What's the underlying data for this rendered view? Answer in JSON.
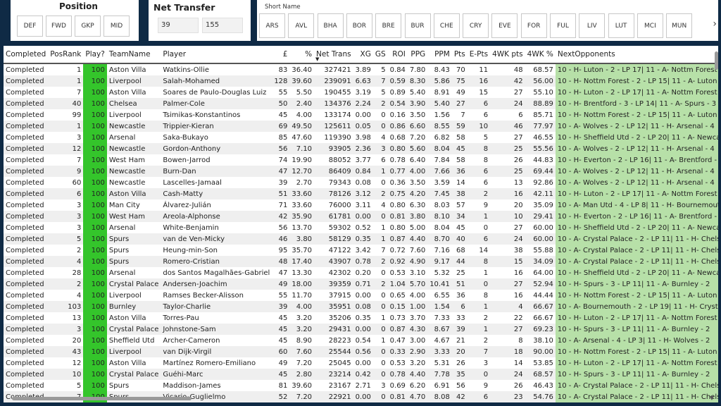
{
  "position_slicer": {
    "title": "Position",
    "options": [
      "DEF",
      "FWD",
      "GKP",
      "MID"
    ]
  },
  "net_transfer": {
    "title": "Net Transfer",
    "min": "39",
    "max": "155"
  },
  "short_name": {
    "title": "Short Name",
    "options": [
      "ARS",
      "AVL",
      "BHA",
      "BOR",
      "BRE",
      "BUR",
      "CHE",
      "CRY",
      "EVE",
      "FOR",
      "FUL",
      "LIV",
      "LUT",
      "MCI",
      "MUN"
    ],
    "next_icon": "chevron-right-icon"
  },
  "table": {
    "headers": [
      "Completed",
      "PosRank",
      "Play?",
      "TeamName",
      "Player",
      "£",
      "%",
      "Net Trans",
      "XG",
      "GS",
      "ROI",
      "PPG",
      "PPM",
      "Pts",
      "E-Pts",
      "4WK pts",
      "4WK %",
      "NextOpponents"
    ],
    "sorted_column": "Net Trans",
    "colors": {
      "play": "#34c52b",
      "next": "#b7e0a8"
    },
    "rows": [
      [
        "Completed",
        "1",
        "100",
        "Aston Villa",
        "Watkins-Ollie",
        "83",
        "36.40",
        "327421",
        "3.89",
        "5",
        "0.84",
        "7.80",
        "8.43",
        "70",
        "11",
        "48",
        "68.57",
        "10 - H- Luton - 2 - LP 17| 11 - A- Nottm Forest"
      ],
      [
        "Completed",
        "1",
        "100",
        "Liverpool",
        "Salah-Mohamed",
        "128",
        "39.60",
        "239091",
        "6.63",
        "7",
        "0.59",
        "8.30",
        "5.86",
        "75",
        "16",
        "42",
        "56.00",
        "10 - H- Nottm Forest - 2 - LP 15| 11 - A- Luton"
      ],
      [
        "Completed",
        "7",
        "100",
        "Aston Villa",
        "Soares de Paulo-Douglas Luiz",
        "55",
        "5.50",
        "190455",
        "3.19",
        "5",
        "0.89",
        "5.40",
        "8.91",
        "49",
        "15",
        "27",
        "55.10",
        "10 - H- Luton - 2 - LP 17| 11 - A- Nottm Forest"
      ],
      [
        "Completed",
        "40",
        "100",
        "Chelsea",
        "Palmer-Cole",
        "50",
        "2.40",
        "134376",
        "2.24",
        "2",
        "0.54",
        "3.90",
        "5.40",
        "27",
        "6",
        "24",
        "88.89",
        "10 - H- Brentford - 3 - LP 14| 11 - A- Spurs - 3"
      ],
      [
        "Completed",
        "99",
        "100",
        "Liverpool",
        "Tsimikas-Konstantinos",
        "45",
        "4.00",
        "133174",
        "0.00",
        "0",
        "0.16",
        "3.50",
        "1.56",
        "7",
        "6",
        "6",
        "85.71",
        "10 - H- Nottm Forest - 2 - LP 15| 11 - A- Luton"
      ],
      [
        "Completed",
        "1",
        "100",
        "Newcastle",
        "Trippier-Kieran",
        "69",
        "49.50",
        "125611",
        "0.05",
        "0",
        "0.86",
        "6.60",
        "8.55",
        "59",
        "10",
        "46",
        "77.97",
        "10 - A- Wolves - 2 - LP 12| 11 - H- Arsenal - 4"
      ],
      [
        "Completed",
        "3",
        "100",
        "Arsenal",
        "Saka-Bukayo",
        "85",
        "47.60",
        "119390",
        "3.98",
        "4",
        "0.68",
        "7.20",
        "6.82",
        "58",
        "5",
        "27",
        "46.55",
        "10 - H- Sheffield Utd - 2 - LP 20| 11 - A- Newcastle"
      ],
      [
        "Completed",
        "12",
        "100",
        "Newcastle",
        "Gordon-Anthony",
        "56",
        "7.10",
        "93905",
        "2.36",
        "3",
        "0.80",
        "5.60",
        "8.04",
        "45",
        "8",
        "25",
        "55.56",
        "10 - A- Wolves - 2 - LP 12| 11 - H- Arsenal - 4"
      ],
      [
        "Completed",
        "7",
        "100",
        "West Ham",
        "Bowen-Jarrod",
        "74",
        "19.90",
        "88052",
        "3.77",
        "6",
        "0.78",
        "6.40",
        "7.84",
        "58",
        "8",
        "26",
        "44.83",
        "10 - H- Everton - 2 - LP 16| 11 - A- Brentford - 3"
      ],
      [
        "Completed",
        "9",
        "100",
        "Newcastle",
        "Burn-Dan",
        "47",
        "12.70",
        "86409",
        "0.84",
        "1",
        "0.77",
        "4.00",
        "7.66",
        "36",
        "6",
        "25",
        "69.44",
        "10 - A- Wolves - 2 - LP 12| 11 - H- Arsenal - 4"
      ],
      [
        "Completed",
        "60",
        "100",
        "Newcastle",
        "Lascelles-Jamaal",
        "39",
        "2.70",
        "79343",
        "0.08",
        "0",
        "0.36",
        "3.50",
        "3.59",
        "14",
        "6",
        "13",
        "92.86",
        "10 - A- Wolves - 2 - LP 12| 11 - H- Arsenal - 4"
      ],
      [
        "Completed",
        "6",
        "100",
        "Aston Villa",
        "Cash-Matty",
        "51",
        "33.60",
        "78126",
        "3.12",
        "2",
        "0.75",
        "4.20",
        "7.45",
        "38",
        "2",
        "16",
        "42.11",
        "10 - H- Luton - 2 - LP 17| 11 - A- Nottm Forest"
      ],
      [
        "Completed",
        "3",
        "100",
        "Man City",
        "Álvarez-Julián",
        "71",
        "33.60",
        "76000",
        "3.11",
        "4",
        "0.80",
        "6.30",
        "8.03",
        "57",
        "9",
        "20",
        "35.09",
        "10 - A- Man Utd - 4 - LP 8| 11 - H- Bournemouth"
      ],
      [
        "Completed",
        "3",
        "100",
        "West Ham",
        "Areola-Alphonse",
        "42",
        "35.90",
        "61781",
        "0.00",
        "0",
        "0.81",
        "3.80",
        "8.10",
        "34",
        "1",
        "10",
        "29.41",
        "10 - H- Everton - 2 - LP 16| 11 - A- Brentford - 3"
      ],
      [
        "Completed",
        "3",
        "100",
        "Arsenal",
        "White-Benjamin",
        "56",
        "13.70",
        "59302",
        "0.52",
        "1",
        "0.80",
        "5.00",
        "8.04",
        "45",
        "0",
        "27",
        "60.00",
        "10 - H- Sheffield Utd - 2 - LP 20| 11 - A- Newcastle"
      ],
      [
        "Completed",
        "5",
        "100",
        "Spurs",
        "van de Ven-Micky",
        "46",
        "3.80",
        "58129",
        "0.35",
        "1",
        "0.87",
        "4.40",
        "8.70",
        "40",
        "6",
        "24",
        "60.00",
        "10 - A- Crystal Palace - 2 - LP 11| 11 - H- Chelsea"
      ],
      [
        "Completed",
        "2",
        "100",
        "Spurs",
        "Heung-min-Son",
        "95",
        "35.70",
        "47122",
        "3.42",
        "7",
        "0.72",
        "7.60",
        "7.16",
        "68",
        "14",
        "38",
        "55.88",
        "10 - A- Crystal Palace - 2 - LP 11| 11 - H- Chelsea"
      ],
      [
        "Completed",
        "4",
        "100",
        "Spurs",
        "Romero-Cristian",
        "48",
        "17.40",
        "43907",
        "0.78",
        "2",
        "0.92",
        "4.90",
        "9.17",
        "44",
        "8",
        "15",
        "34.09",
        "10 - A- Crystal Palace - 2 - LP 11| 11 - H- Chelsea"
      ],
      [
        "Completed",
        "28",
        "100",
        "Arsenal",
        "dos Santos Magalhães-Gabriel",
        "47",
        "13.30",
        "42302",
        "0.20",
        "0",
        "0.53",
        "3.10",
        "5.32",
        "25",
        "1",
        "16",
        "64.00",
        "10 - H- Sheffield Utd - 2 - LP 20| 11 - A- Newcastle"
      ],
      [
        "Completed",
        "2",
        "100",
        "Crystal Palace",
        "Andersen-Joachim",
        "49",
        "18.00",
        "39359",
        "0.71",
        "2",
        "1.04",
        "5.70",
        "10.41",
        "51",
        "0",
        "27",
        "52.94",
        "10 - H- Spurs - 3 - LP 11| 11 - A- Burnley - 2"
      ],
      [
        "Completed",
        "4",
        "100",
        "Liverpool",
        "Ramses Becker-Alisson",
        "55",
        "11.70",
        "37915",
        "0.00",
        "0",
        "0.65",
        "4.00",
        "6.55",
        "36",
        "8",
        "16",
        "44.44",
        "10 - H- Nottm Forest - 2 - LP 15| 11 - A- Luton"
      ],
      [
        "Completed",
        "103",
        "100",
        "Burnley",
        "Taylor-Charlie",
        "39",
        "4.00",
        "35951",
        "0.08",
        "0",
        "0.15",
        "1.00",
        "1.54",
        "6",
        "1",
        "4",
        "66.67",
        "10 - A- Bournemouth - 2 - LP 19| 11 - H- Crystal Palace"
      ],
      [
        "Completed",
        "13",
        "100",
        "Aston Villa",
        "Torres-Pau",
        "45",
        "3.20",
        "35206",
        "0.35",
        "1",
        "0.73",
        "3.70",
        "7.33",
        "33",
        "2",
        "22",
        "66.67",
        "10 - H- Luton - 2 - LP 17| 11 - A- Nottm Forest"
      ],
      [
        "Completed",
        "3",
        "100",
        "Crystal Palace",
        "Johnstone-Sam",
        "45",
        "3.20",
        "29431",
        "0.00",
        "0",
        "0.87",
        "4.30",
        "8.67",
        "39",
        "1",
        "27",
        "69.23",
        "10 - H- Spurs - 3 - LP 11| 11 - A- Burnley - 2"
      ],
      [
        "Completed",
        "20",
        "100",
        "Sheffield Utd",
        "Archer-Cameron",
        "45",
        "8.90",
        "28223",
        "0.54",
        "1",
        "0.47",
        "3.00",
        "4.67",
        "21",
        "2",
        "8",
        "38.10",
        "10 - A- Arsenal - 4 - LP 3| 11 - H- Wolves - 2"
      ],
      [
        "Completed",
        "43",
        "100",
        "Liverpool",
        "van Dijk-Virgil",
        "60",
        "7.60",
        "25544",
        "0.56",
        "0",
        "0.33",
        "2.90",
        "3.33",
        "20",
        "7",
        "18",
        "90.00",
        "10 - H- Nottm Forest - 2 - LP 15| 11 - A- Luton"
      ],
      [
        "Completed",
        "12",
        "100",
        "Aston Villa",
        "Martínez Romero-Emiliano",
        "49",
        "7.20",
        "25045",
        "0.00",
        "0",
        "0.53",
        "3.20",
        "5.31",
        "26",
        "3",
        "14",
        "53.85",
        "10 - H- Luton - 2 - LP 17| 11 - A- Nottm Forest"
      ],
      [
        "Completed",
        "10",
        "100",
        "Crystal Palace",
        "Guéhi-Marc",
        "45",
        "2.80",
        "23214",
        "0.42",
        "0",
        "0.78",
        "4.40",
        "7.78",
        "35",
        "0",
        "24",
        "68.57",
        "10 - H- Spurs - 3 - LP 11| 11 - A- Burnley - 2"
      ],
      [
        "Completed",
        "5",
        "100",
        "Spurs",
        "Maddison-James",
        "81",
        "39.60",
        "23167",
        "2.71",
        "3",
        "0.69",
        "6.20",
        "6.91",
        "56",
        "9",
        "26",
        "46.43",
        "10 - A- Crystal Palace - 2 - LP 11| 11 - H- Chelsea"
      ],
      [
        "Completed",
        "7",
        "100",
        "Spurs",
        "Vicario-Guglielmo",
        "52",
        "7.20",
        "22921",
        "0.00",
        "0",
        "0.81",
        "4.70",
        "8.08",
        "42",
        "6",
        "23",
        "54.76",
        "10 - A- Crystal Palace - 2 - LP 11| 11 - H- Chelsea"
      ]
    ]
  }
}
